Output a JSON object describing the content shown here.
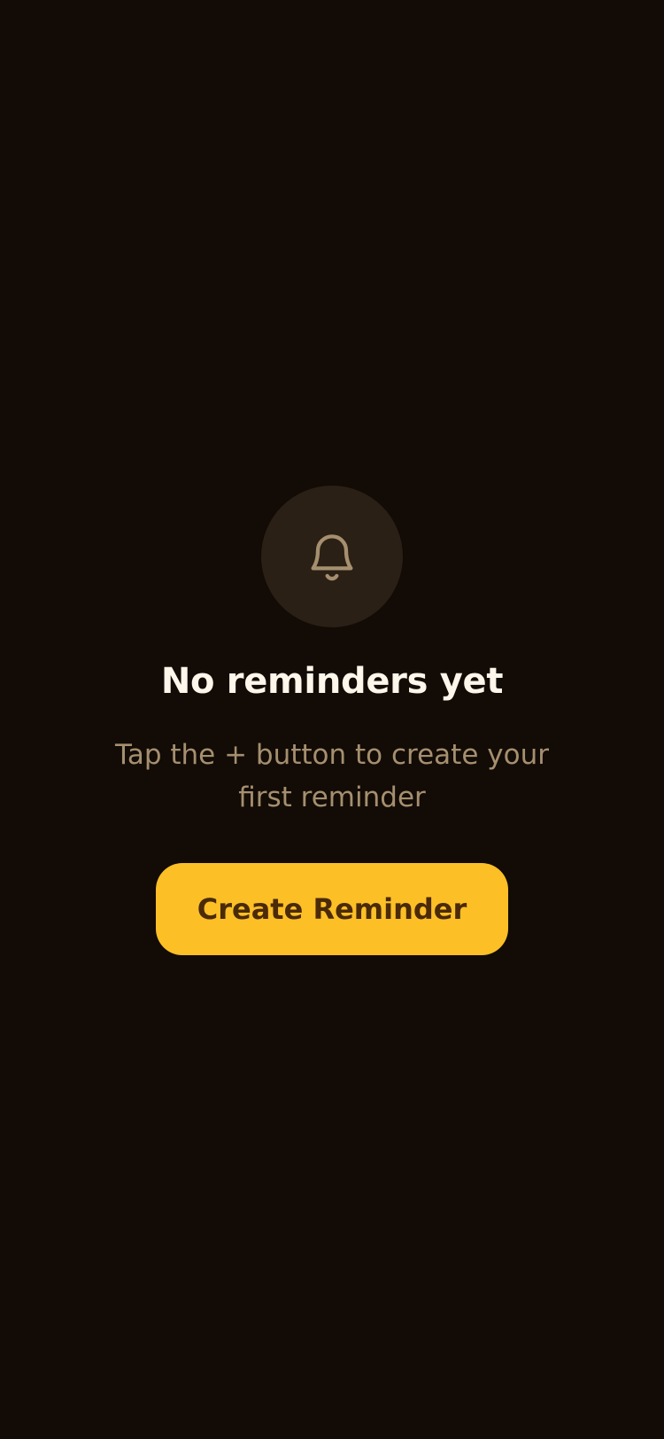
{
  "empty_state": {
    "icon": "bell-icon",
    "title": "No reminders yet",
    "subtitle": "Tap the + button to create your first reminder",
    "button_label": "Create Reminder"
  },
  "colors": {
    "background": "#120b06",
    "icon_circle": "#2a2015",
    "icon_stroke": "#a58f6f",
    "title_text": "#fdf6ea",
    "subtitle_text": "#a58f6f",
    "button_background": "#fcbf26",
    "button_text": "#4a2a08"
  }
}
